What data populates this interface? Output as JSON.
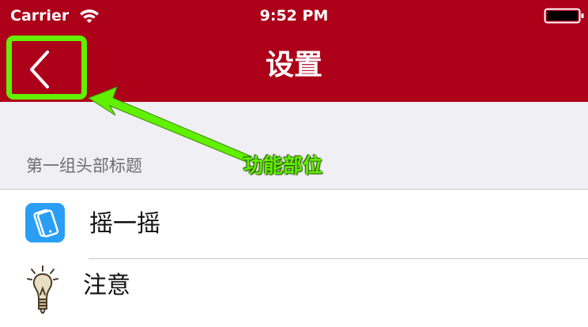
{
  "status_bar": {
    "carrier": "Carrier",
    "time": "9:52 PM",
    "wifi_icon": "wifi-icon",
    "battery_icon": "battery-icon"
  },
  "nav_bar": {
    "title": "设置",
    "back_icon": "chevron-left-icon",
    "background_color": "#ad0019"
  },
  "annotation": {
    "label": "功能部位",
    "color": "#60f000"
  },
  "section": {
    "header": "第一组头部标题"
  },
  "rows": [
    {
      "label": "摇一摇",
      "icon": "shake-phone-icon"
    },
    {
      "label": "注意",
      "icon": "lightbulb-icon"
    }
  ]
}
